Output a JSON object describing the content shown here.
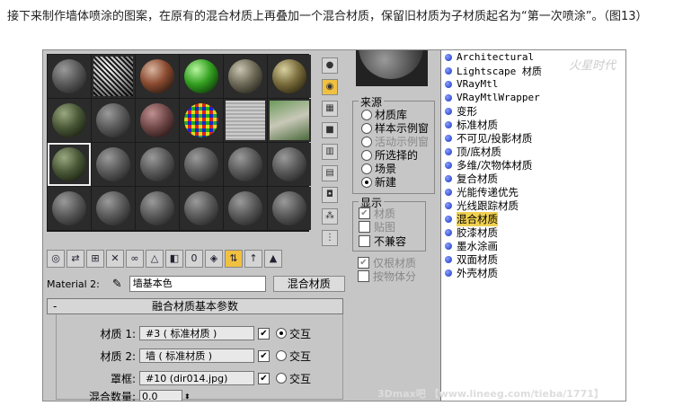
{
  "caption": "接下来制作墙体喷涂的图案，在原有的混合材质上再叠加一个混合材质，保留旧材质为子材质起名为“第一次喷涂”。（图13）",
  "toolbar_icons": [
    "get-material",
    "put-to-scene",
    "assign",
    "reset",
    "delete",
    "make-unique",
    "put-library",
    "material-effects",
    "show-map",
    "show-end-result",
    "go-to-parent",
    "go-forward-sibling"
  ],
  "material2_label": "Material 2:",
  "material_name": "墙基本色",
  "type_button": "混合材质",
  "rollout": {
    "marker": "-",
    "title": "融合材质基本参数",
    "mat1_label": "材质 1:",
    "mat1_value": "#3   ( 标准材质 )",
    "mat2_label": "材质 2:",
    "mat2_value": "墙   ( 标准材质 )",
    "mask_label": "罩框:",
    "mask_value": "#10 (dir014.jpg)",
    "interactive": "交互",
    "mix_label": "混合数量:",
    "mix_value": "0.0"
  },
  "source": {
    "title": "来源",
    "options": [
      "材质库",
      "样本示例窗",
      "活动示例窗",
      "所选择的",
      "场景",
      "新建"
    ],
    "selected": "新建"
  },
  "show": {
    "title": "显示",
    "items": [
      "材质",
      "贴图",
      "不兼容"
    ],
    "root_only": "仅根材质",
    "by_object": "按物体分"
  },
  "material_list": [
    "Architectural",
    "Lightscape 材质",
    "VRayMtl",
    "VRayMtlWrapper",
    "变形",
    "标准材质",
    "不可见/投影材质",
    "顶/底材质",
    "多维/次物体材质",
    "复合材质",
    "光能传递优先",
    "光线跟踪材质",
    "混合材质",
    "胶漆材质",
    "墨水涂画",
    "双面材质",
    "外壳材质"
  ],
  "highlighted": "混合材质",
  "watermark": "火星时代",
  "footer": "3Dmax吧 【www.lineeg.com/tieba/1771】"
}
